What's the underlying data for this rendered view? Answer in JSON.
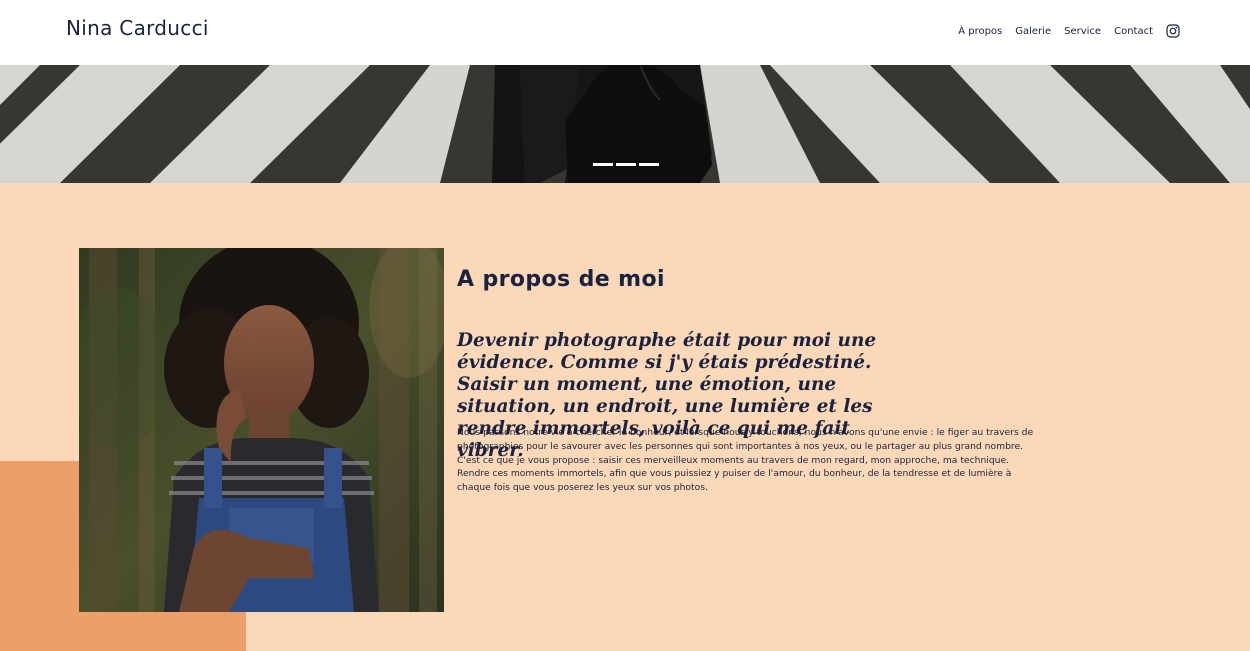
{
  "header": {
    "brand": "Nina Carducci",
    "nav": {
      "about": "À propos",
      "gallery": "Galerie",
      "service": "Service",
      "contact": "Contact"
    },
    "instagram_icon": "instagram-icon"
  },
  "hero": {
    "slide_count": 3
  },
  "about": {
    "title": "A propos de moi",
    "tagline": "Devenir photographe était pour moi une évidence. Comme si j'y étais prédestiné. Saisir un moment, une émotion, une situation, un endroit, une lumière et les rendre immortels, voilà ce qui me fait vibrer.",
    "body": "Nous passons notre vie à chercher le bonheur, et lorsque nous y touchons, nous n'avons qu'une envie : le figer au travers de photographies pour le savourer avec les personnes qui sont importantes à nos yeux, ou le partager au plus grand nombre. C'est ce que je vous propose : saisir ces merveilleux moments au travers de mon regard, mon approche, ma technique. Rendre ces moments immortels, afin que vous puissiez y puiser de l'amour, du bonheur, de la tendresse et de lumière à chaque fois que vous poserez les yeux sur vos photos."
  },
  "colors": {
    "section_bg": "#fbd8b8",
    "accent_block": "#eba06a",
    "text": "#1a2240",
    "header_bg": "#ffffff"
  }
}
